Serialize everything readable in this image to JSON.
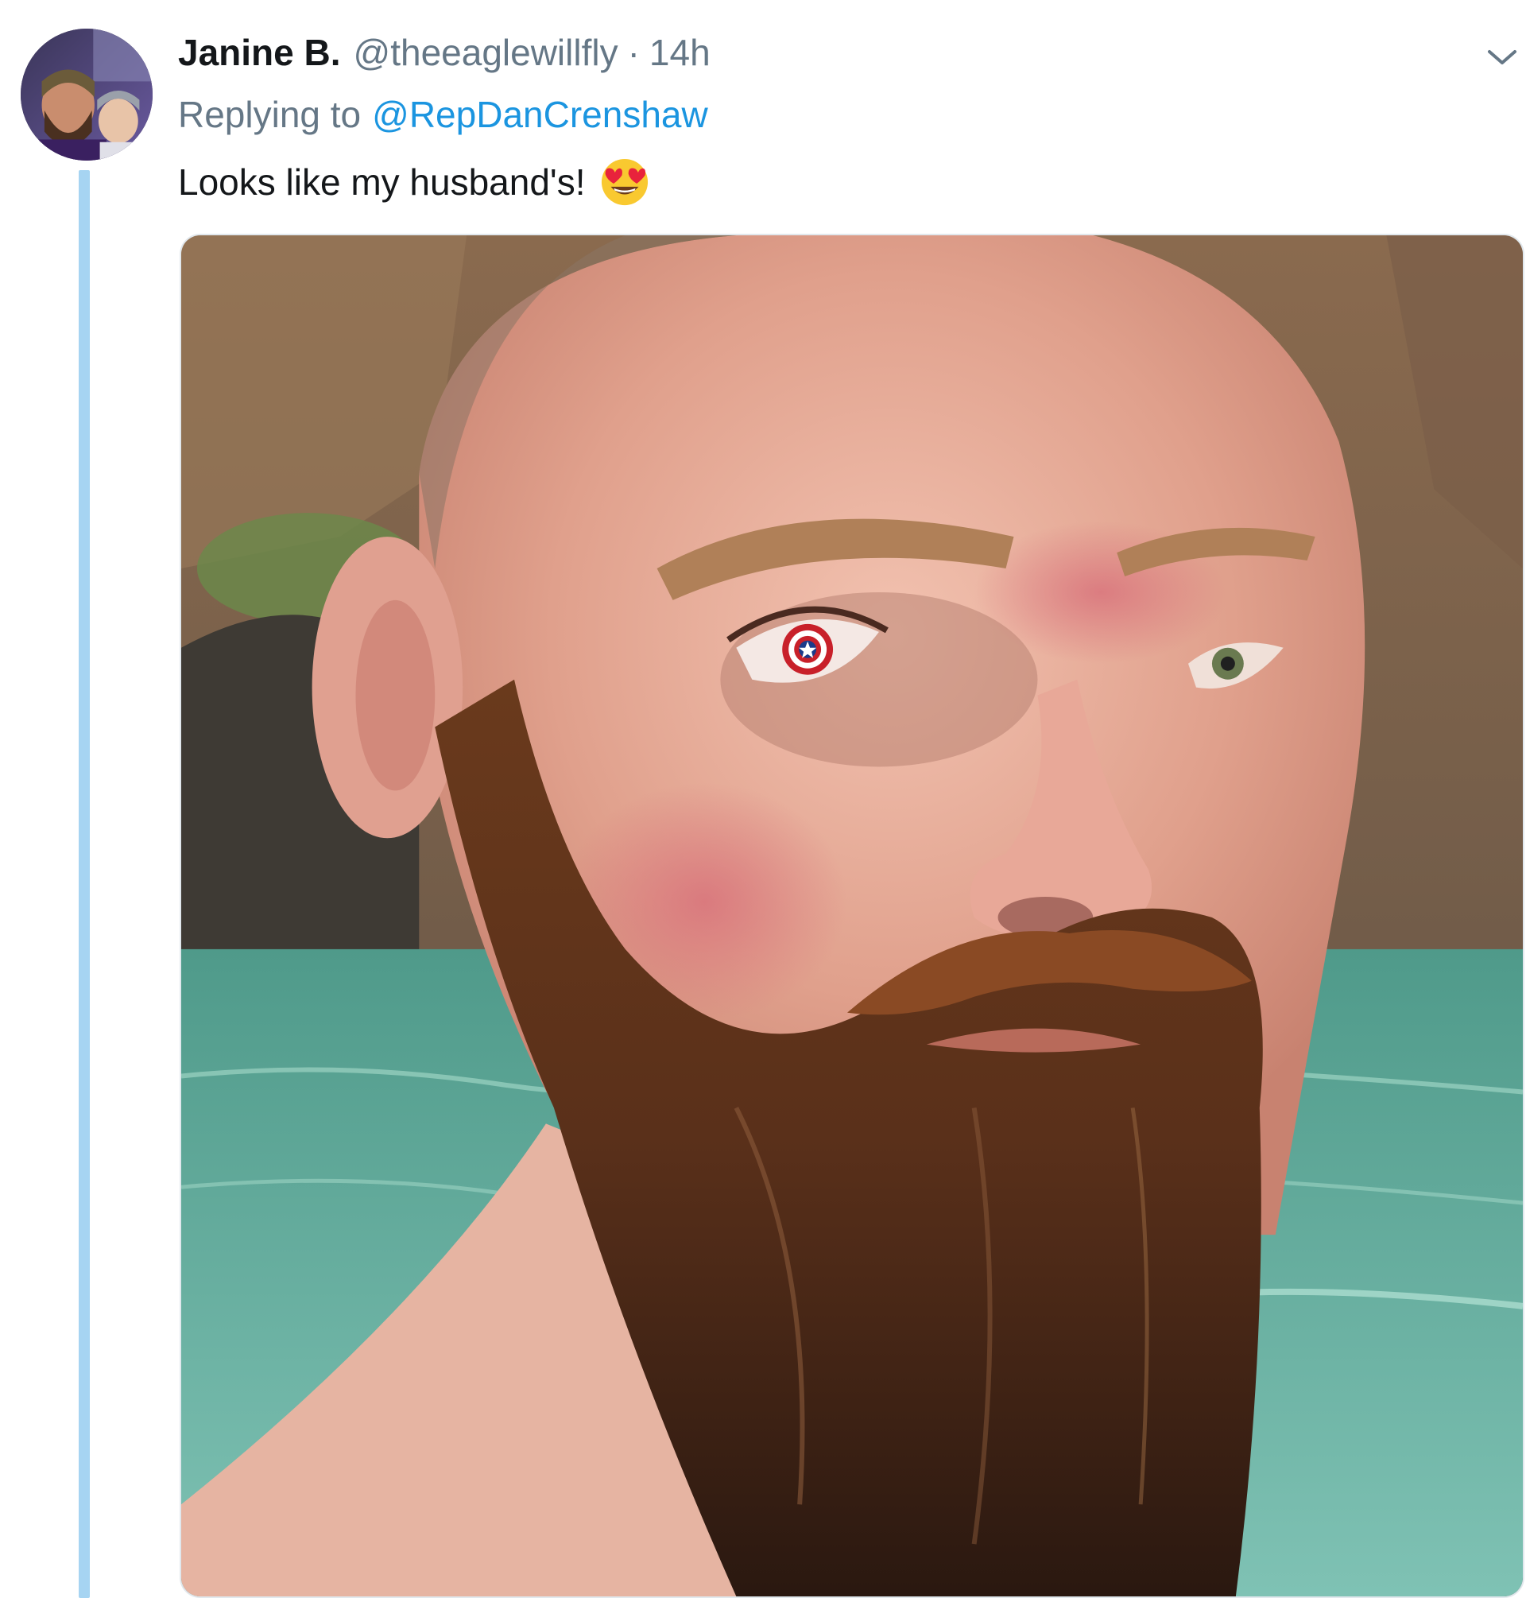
{
  "tweet": {
    "display_name": "Janine B.",
    "handle": "@theeaglewillfly",
    "separator": "·",
    "timestamp": "14h",
    "replying_prefix": "Replying to",
    "replying_to": "@RepDanCrenshaw",
    "text": "Looks like my husband's!",
    "emoji": "heart-eyes-emoji",
    "caret_icon": "chevron-down-icon"
  },
  "colors": {
    "name": "#14171a",
    "secondary": "#657786",
    "link": "#1b95e0",
    "thread_line": "#a6d4f2"
  }
}
